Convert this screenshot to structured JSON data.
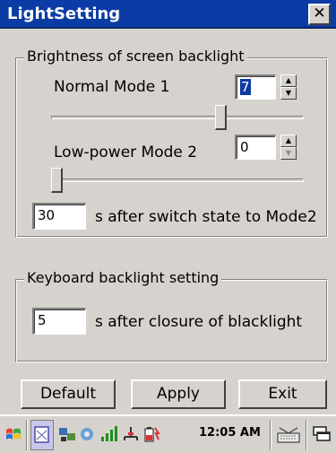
{
  "window": {
    "title": "LightSetting",
    "close_symbol": "✕"
  },
  "screen_backlight": {
    "legend": "Brightness of screen backlight",
    "normal_mode_label": "Normal Mode 1",
    "normal_mode_value": "7",
    "normal_slider_level": 0.68,
    "low_power_label": "Low-power Mode 2",
    "low_power_value": "0",
    "low_power_slider_level": 0.0,
    "switch_seconds_value": "30",
    "switch_text": "s after switch state to Mode2"
  },
  "keyboard_backlight": {
    "legend": "Keyboard backlight setting",
    "seconds_value": "5",
    "closure_text": "s after closure of blacklight"
  },
  "buttons": {
    "default_label": "Default",
    "apply_label": "Apply",
    "exit_label": "Exit"
  },
  "taskbar": {
    "clock": "12:05 AM",
    "icons": [
      "start-flag-icon",
      "app-window-icon",
      "network-icon",
      "sync-icon",
      "signal-icon",
      "connection-icon",
      "battery-icon",
      "keyboard-icon",
      "desktop-icon"
    ]
  },
  "colors": {
    "titlebar": "#0b3ca5",
    "window_bg": "#d6d3ce",
    "selection": "#0b3ca5"
  }
}
